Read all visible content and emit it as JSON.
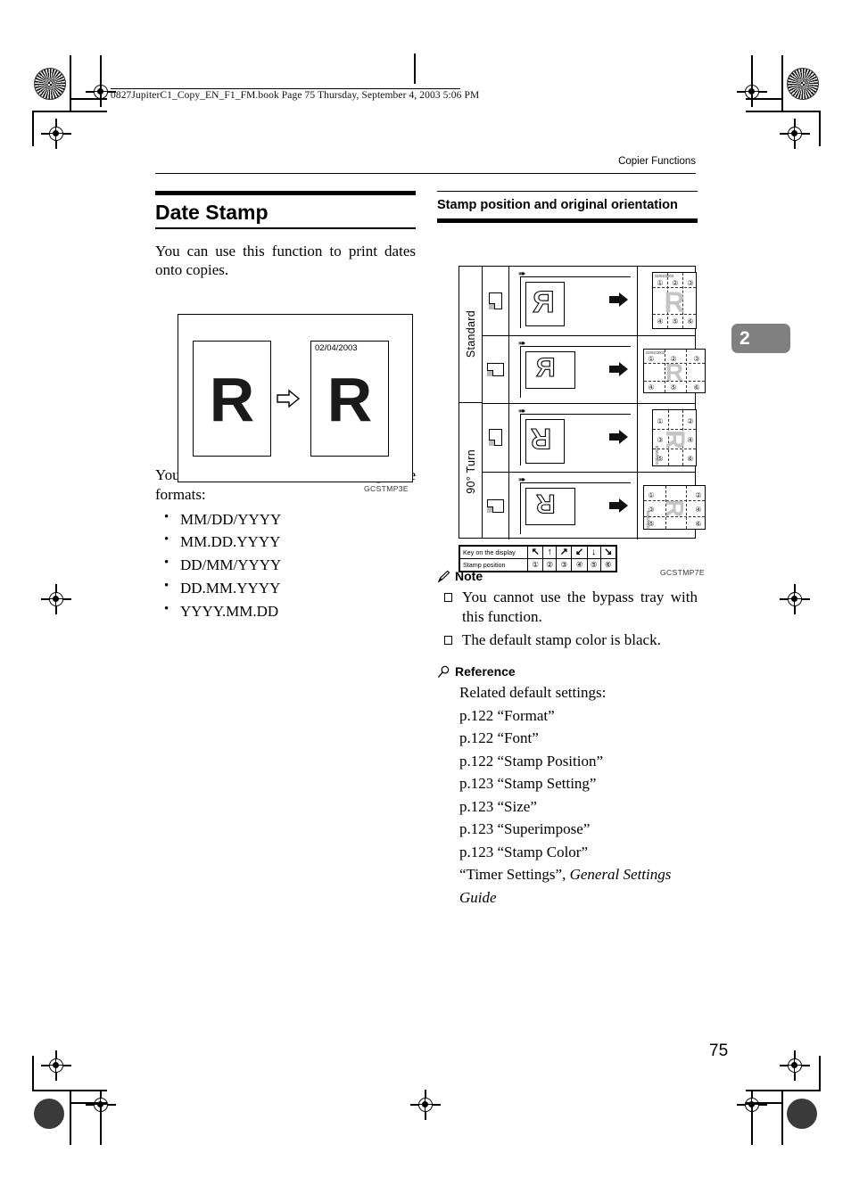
{
  "file_header": "0827JupiterC1_Copy_EN_F1_FM.book  Page 75  Thursday, September 4, 2003  5:06 PM",
  "running_head": "Copier Functions",
  "chapter_tab": "2",
  "page_number": "75",
  "left_column": {
    "section_title": "Date Stamp",
    "intro": "You can use this function to print dates onto copies.",
    "figure": {
      "date_label": "02/04/2003",
      "letter": "R",
      "arrow": "right-arrow-outline",
      "caption": "GCSTMP3E"
    },
    "formats_intro": "You can select from the following date formats:",
    "formats": [
      "MM/DD/YYYY",
      "MM.DD.YYYY",
      "DD/MM/YYYY",
      "DD.MM.YYYY",
      "YYYY.MM.DD"
    ]
  },
  "right_column": {
    "subtitle": "Stamp position and original orientation",
    "diagram": {
      "caption": "GCSTMP7E",
      "groups": [
        {
          "label": "Standard"
        },
        {
          "label": "90° Turn"
        }
      ],
      "rows": [
        {
          "orientation_icon": "portrait-page-icon",
          "original_letter": "R",
          "output": "portrait",
          "numbers": [
            "1",
            "2",
            "3",
            "4",
            "5",
            "6"
          ]
        },
        {
          "orientation_icon": "landscape-page-icon",
          "original_letter": "R",
          "output": "landscape",
          "numbers": [
            "1",
            "2",
            "3",
            "4",
            "5",
            "6"
          ]
        },
        {
          "orientation_icon": "portrait-page-icon",
          "original_letter": "R",
          "output": "portrait-turned",
          "numbers": [
            "1",
            "2",
            "3",
            "4",
            "5",
            "6"
          ]
        },
        {
          "orientation_icon": "landscape-page-icon",
          "original_letter": "R",
          "output": "landscape-turned",
          "numbers": [
            "1",
            "2",
            "3",
            "4",
            "5",
            "6"
          ]
        }
      ],
      "date_text": "02/04/2003"
    },
    "legend": {
      "row1_label": "Key on the display",
      "row2_label": "Stamp position",
      "arrows": [
        "↖",
        "↑",
        "↗",
        "↙",
        "↓",
        "↘"
      ],
      "positions": [
        "①",
        "②",
        "③",
        "④",
        "⑤",
        "⑥"
      ]
    },
    "note": {
      "icon": "pencil-icon",
      "heading": "Note",
      "items": [
        "You cannot use the bypass tray with this function.",
        "The default stamp color is black."
      ]
    },
    "reference": {
      "icon": "magnifier-icon",
      "heading": "Reference",
      "intro": "Related default settings:",
      "items": [
        "p.122 “Format”",
        "p.122 “Font”",
        "p.122 “Stamp Position”",
        "p.123 “Stamp Setting”",
        "p.123 “Size”",
        "p.123 “Superimpose”",
        "p.123 “Stamp Color”"
      ],
      "last_item_plain": "“Timer Settings”, ",
      "last_item_italic": "General Settings Guide"
    }
  }
}
